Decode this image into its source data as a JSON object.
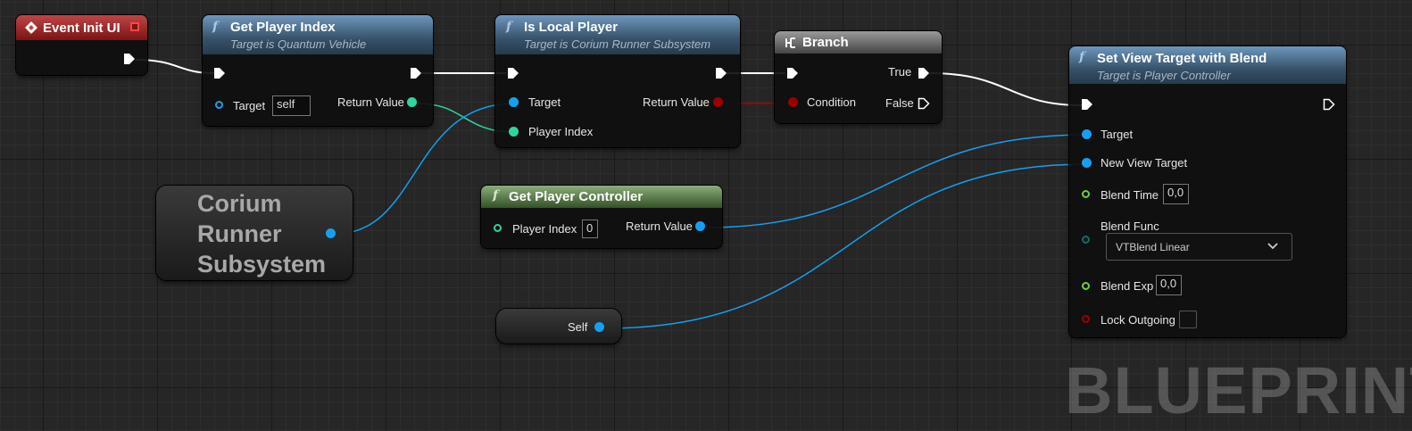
{
  "nodes": {
    "event_init_ui": {
      "title": "Event Init UI"
    },
    "get_player_index": {
      "title": "Get Player Index",
      "subtitle": "Target is Quantum Vehicle",
      "target_label": "Target",
      "target_value": "self",
      "return_label": "Return Value"
    },
    "is_local_player": {
      "title": "Is Local Player",
      "subtitle": "Target is Corium Runner Subsystem",
      "target_label": "Target",
      "player_index_label": "Player Index",
      "return_label": "Return Value"
    },
    "branch": {
      "title": "Branch",
      "true_label": "True",
      "false_label": "False",
      "condition_label": "Condition"
    },
    "corium_runner_subsystem": {
      "title": "Corium Runner Subsystem"
    },
    "get_player_controller": {
      "title": "Get Player Controller",
      "player_index_label": "Player Index",
      "player_index_value": "0",
      "return_label": "Return Value"
    },
    "self_node": {
      "label": "Self"
    },
    "set_view_target": {
      "title": "Set View Target with Blend",
      "subtitle": "Target is Player Controller",
      "target_label": "Target",
      "new_view_target_label": "New View Target",
      "blend_time_label": "Blend Time",
      "blend_time_value": "0,0",
      "blend_func_label": "Blend Func",
      "blend_func_value": "VTBlend Linear",
      "blend_exp_label": "Blend Exp",
      "blend_exp_value": "0,0",
      "lock_outgoing_label": "Lock Outgoing"
    }
  },
  "watermark": "BLUEPRINT",
  "colors": {
    "exec": "#ffffff",
    "object": "#14a0f0",
    "integer": "#2ed69b",
    "boolean": "#9b0000",
    "float": "#6ad23a",
    "byte": "#0e6e6a"
  },
  "icons": {
    "function": "function-icon",
    "event": "event-diamond-icon",
    "branch": "branch-icon",
    "dropdown": "chevron-down-icon"
  }
}
